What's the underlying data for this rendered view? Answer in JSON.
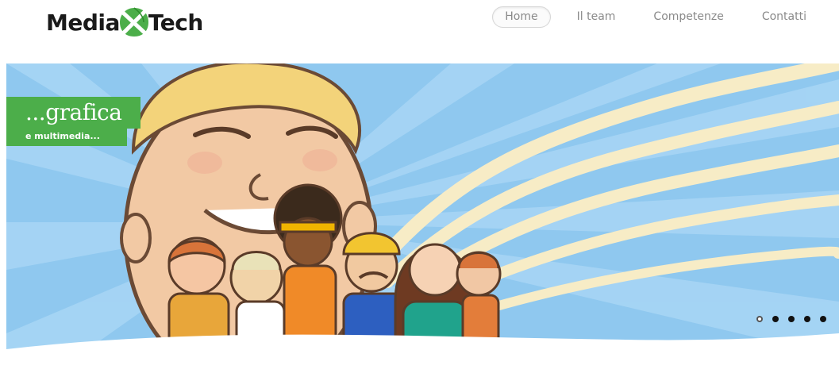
{
  "header": {
    "logo": {
      "text_left": "Media",
      "text_right": "Tech",
      "mark_icon": "x-leaf-logo-mark",
      "brand_color": "#4cae4a"
    },
    "nav": [
      {
        "label": "Home",
        "active": true
      },
      {
        "label": "Il team",
        "active": false
      },
      {
        "label": "Competenze",
        "active": false
      },
      {
        "label": "Contatti",
        "active": false
      }
    ]
  },
  "hero": {
    "caption_title": "...grafica",
    "caption_subtitle": "e multimedia...",
    "caption_color": "#4cae4a",
    "sky_color": "#8fc8ef",
    "slides_total": 5,
    "slide_active": 1
  }
}
